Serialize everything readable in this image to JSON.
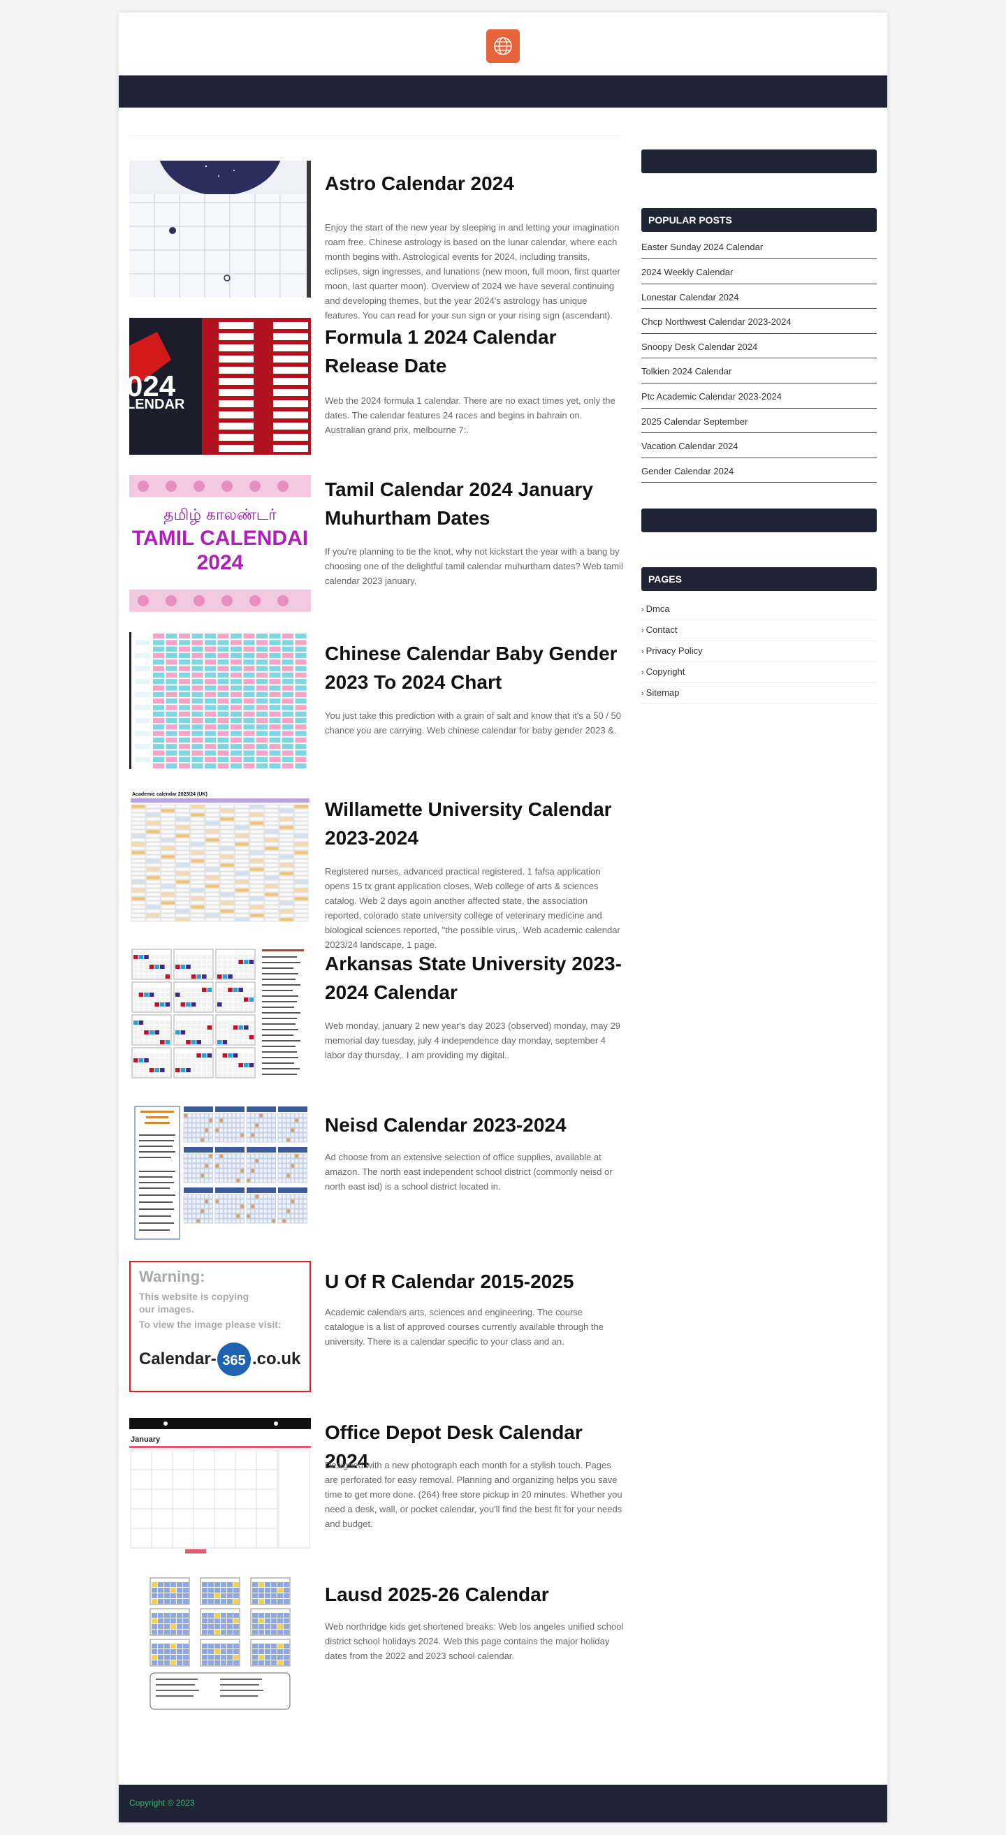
{
  "site": {
    "footer_text": "Copyright © 2023",
    "logo_icon": "globe-icon",
    "accent_color": "#e8633a",
    "nav_color": "#1e2433"
  },
  "posts": [
    {
      "title": "Astro Calendar 2024",
      "excerpt": "Enjoy the start of the new year by sleeping in and letting your imagination roam free. Chinese astrology is based on the lunar calendar, where each month begins with. Astrological events for 2024, including transits, eclipses, sign ingresses, and lunations (new moon, full moon, first quarter moon, last quarter moon). Overview of 2024 we have several continuing and developing themes, but the year 2024's astrology has unique features. You can read for your sun sign or your rising sign (ascendant)."
    },
    {
      "title": "Formula 1 2024 Calendar Release Date",
      "excerpt": "Web the 2024 formula 1 calendar. There are no exact times yet, only the dates. The calendar features 24 races and begins in bahrain on. Australian grand prix, melbourne 7:."
    },
    {
      "title": "Tamil Calendar 2024 January Muhurtham Dates",
      "excerpt": "If you're planning to tie the knot, why not kickstart the year with a bang by choosing one of the delightful tamil calendar muhurtham dates? Web tamil calendar 2023 january."
    },
    {
      "title": "Chinese Calendar Baby Gender 2023 To 2024 Chart",
      "excerpt": "You just take this prediction with a grain of salt and know that it's a 50 / 50 chance you are carrying. Web chinese calendar for baby gender 2023 &."
    },
    {
      "title": "Willamette University Calendar 2023-2024",
      "excerpt": "Registered nurses, advanced practical registered. 1 fafsa application opens 15 tx grant application closes. Web college of arts & sciences catalog. Web 2 days agoin another affected state, the association reported, colorado state university college of veterinary medicine and biological sciences reported, \"the possible virus,. Web academic calendar 2023/24 landscape, 1 page."
    },
    {
      "title": "Arkansas State University 2023-2024 Calendar",
      "excerpt": "Web monday, january 2 new year's day 2023 (observed) monday, may 29 memorial day tuesday, july 4 independence day monday, september 4 labor day thursday,. I am providing my digital.."
    },
    {
      "title": "Neisd Calendar 2023-2024",
      "excerpt": "Ad choose from an extensive selection of office supplies, available at amazon. The north east independent school district (commonly neisd or north east isd) is a school district located in."
    },
    {
      "title": "U Of R Calendar 2015-2025",
      "excerpt": "Academic calendars arts, sciences and engineering. The course catalogue is a list of approved courses currently available through the university. There is a calendar specific to your class and an."
    },
    {
      "title": "Office Depot Desk Calendar 2024",
      "excerpt": "Designed with a new photograph each month for a stylish touch. Pages are perforated for easy removal. Planning and organizing helps you save time to get more done. (264) free store pickup in 20 minutes. Whether you need a desk, wall, or pocket calendar, you'll find the best fit for your needs and budget."
    },
    {
      "title": "Lausd 2025-26 Calendar",
      "excerpt": "Web northridge kids get shortened breaks: Web los angeles unified school district school holidays 2024. Web this page contains the major holiday dates from the 2022 and 2023 school calendar."
    }
  ],
  "thumb_text": {
    "f1_line1": "024",
    "f1_line2": "LENDAR",
    "tamil_script": "தமிழ் காலண்டர்",
    "tamil_latin": "TAMIL CALENDAI",
    "tamil_year": "2024",
    "academic_title": "Academic calendar 2023/24 (UK)",
    "warn_title": "Warning:",
    "warn_l1": "This website is copying",
    "warn_l2": "our images.",
    "warn_l3": "To view the image please visit:",
    "warn_brand_a": "Calendar-",
    "warn_brand_b": "365",
    "warn_brand_c": ".co.uk",
    "office_month": "January"
  },
  "sidebar": {
    "popular_heading": "POPULAR POSTS",
    "popular": [
      "Easter Sunday 2024 Calendar",
      "2024 Weekly Calendar",
      "Lonestar Calendar 2024",
      "Chcp Northwest Calendar 2023-2024",
      "Snoopy Desk Calendar 2024",
      "Tolkien 2024 Calendar",
      "Ptc Academic Calendar 2023-2024",
      "2025 Calendar September",
      "Vacation Calendar 2024",
      "Gender Calendar 2024"
    ],
    "pages_heading": "PAGES",
    "pages": [
      "Dmca",
      "Contact",
      "Privacy Policy",
      "Copyright",
      "Sitemap"
    ]
  }
}
